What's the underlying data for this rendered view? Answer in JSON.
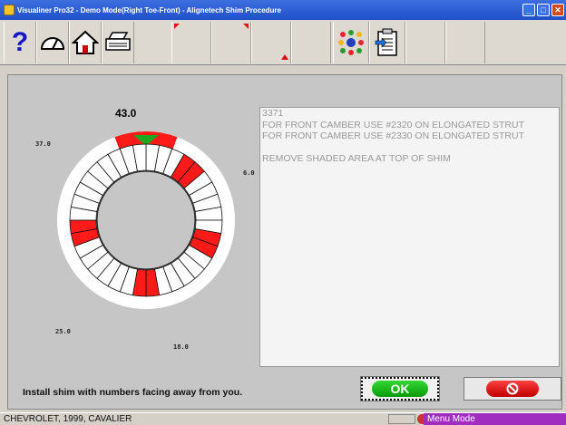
{
  "window": {
    "title": "Visualiner Pro32 - Demo Mode(Right Toe-Front) - Alignetech Shim Procedure",
    "minimize_icon": "minimize-icon",
    "maximize_icon": "maximize-icon",
    "close_icon": "close-icon"
  },
  "toolbar": {
    "buttons": [
      "help-icon",
      "gauge-icon",
      "home-icon",
      "printer-icon",
      "marker-icon",
      "marker-icon",
      "marker-icon",
      "vehicle-specs-icon",
      "clipboard-icon"
    ],
    "help_label": "?"
  },
  "shim": {
    "top_reading": "43.0",
    "labels": {
      "upper_left": "37.0",
      "right": "6.0",
      "lower_left": "25.0",
      "bottom": "18.0"
    },
    "segment_count": 36,
    "red_segments": [
      3,
      4,
      10,
      11,
      17,
      18,
      25,
      26
    ],
    "colors": {
      "red": "#ff1a1a",
      "green": "#1fa81f",
      "ring": "#ffffff"
    }
  },
  "instructions": {
    "lines": [
      "3371",
      "FOR FRONT CAMBER USE #2320 ON ELONGATED STRUT",
      "FOR FRONT CAMBER USE #2330 ON ELONGATED STRUT",
      "",
      "REMOVE SHADED AREA AT TOP OF SHIM"
    ]
  },
  "footer": {
    "install_text": "Install shim with numbers facing away from you.",
    "ok_label": "OK",
    "cancel_icon": "cancel-icon"
  },
  "status": {
    "vehicle": "CHEVROLET, 1999, CAVALIER",
    "mode": "Menu Mode"
  }
}
